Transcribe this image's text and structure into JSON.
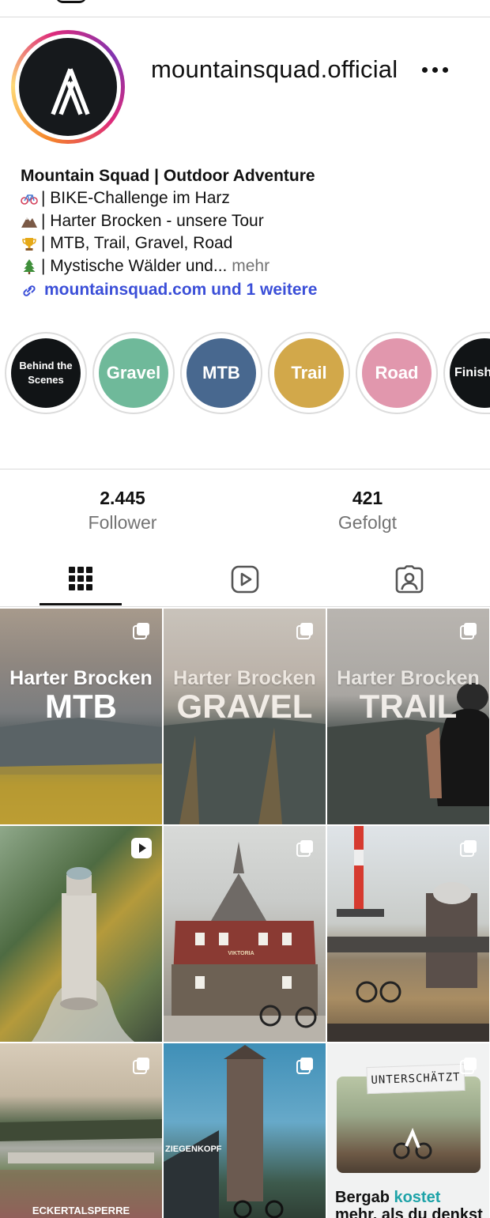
{
  "profile": {
    "username": "mountainsquad.official",
    "name": "Mountain Squad | Outdoor Adventure",
    "bio_lines": [
      {
        "icon": "bike-emoji",
        "text": "| BIKE-Challenge im Harz"
      },
      {
        "icon": "mountain-emoji",
        "text": "| Harter Brocken - unsere Tour"
      },
      {
        "icon": "trophy-emoji",
        "text": "| MTB, Trail, Gravel, Road"
      },
      {
        "icon": "tree-emoji",
        "text": "| Mystische Wälder und..."
      }
    ],
    "more_label": "mehr",
    "link_text": "mountainsquad.com und 1 weitere"
  },
  "highlights": [
    {
      "label": "Behind the Scenes",
      "color": "#111416"
    },
    {
      "label": "Gravel",
      "color": "#6fb99a"
    },
    {
      "label": "MTB",
      "color": "#48688f"
    },
    {
      "label": "Trail",
      "color": "#d2a84a"
    },
    {
      "label": "Road",
      "color": "#e197ad"
    },
    {
      "label": "Finisher",
      "color": "#111416"
    }
  ],
  "stats": {
    "followers_count": "2.445",
    "followers_label": "Follower",
    "following_count": "421",
    "following_label": "Gefolgt"
  },
  "tabs": [
    {
      "icon": "grid-icon",
      "active": true
    },
    {
      "icon": "reels-icon",
      "active": false
    },
    {
      "icon": "tagged-icon",
      "active": false
    }
  ],
  "posts": [
    {
      "title": "Harter Brocken",
      "big": "MTB",
      "badge": "carousel-icon"
    },
    {
      "title": "Harter Brocken",
      "big": "GRAVEL",
      "badge": "carousel-icon"
    },
    {
      "title": "Harter Brocken",
      "big": "TRAIL",
      "badge": "carousel-icon"
    },
    {
      "title": "",
      "big": "",
      "badge": "reel-icon"
    },
    {
      "title": "",
      "big": "VIKTORIA",
      "badge": "carousel-icon"
    },
    {
      "title": "",
      "big": "",
      "badge": "carousel-icon"
    },
    {
      "title": "",
      "big": "ECKERTALSPERRE",
      "badge": "carousel-icon"
    },
    {
      "title": "",
      "big": "ZIEGENKOPF",
      "badge": "carousel-icon"
    },
    {
      "title": "UNTERSCHÄTZT",
      "big": "Bergab kostet mehr, als du denkst",
      "badge": "carousel-icon"
    }
  ],
  "post8_words": {
    "pre": "Bergab ",
    "accent": "kostet",
    "post": "mehr, als du denkst"
  },
  "colors": {
    "link": "#3b4fd8",
    "muted": "#737373",
    "accent_teal": "#1ea3a8"
  }
}
